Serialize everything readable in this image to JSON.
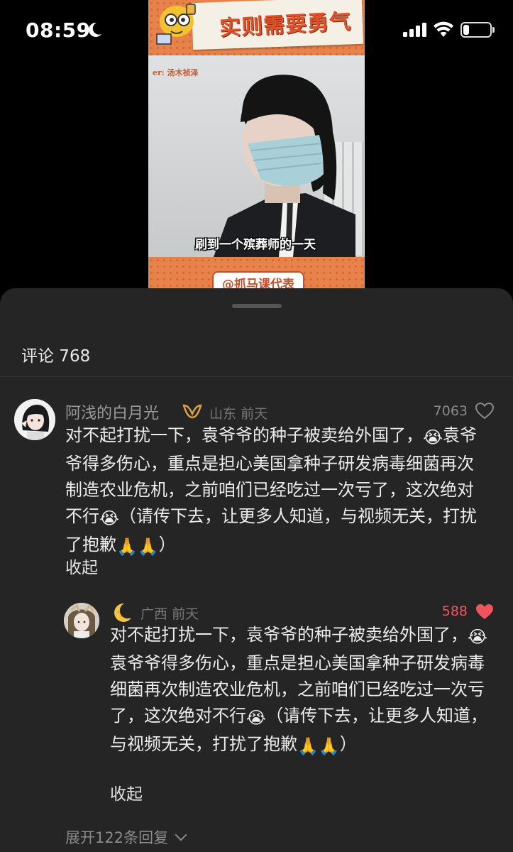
{
  "status_bar": {
    "time": "08:59",
    "battery_level": 0.22
  },
  "video": {
    "headline": "实则需要勇气",
    "credit": "er: 汤木祯泽",
    "caption": "刷到一个殡葬师的一天",
    "handle": "@抓马课代表"
  },
  "comments": {
    "title": "评论 768",
    "main": {
      "username": "阿浅的白月光",
      "location": "山东",
      "time": "前天",
      "likes": "7063",
      "text_1": "对不起打扰一下，袁爷爷的种子被卖给外国了，",
      "emoji_cry": "😭",
      "text_2": "袁爷爷得多伤心，重点是担心美国拿种子研发病毒细菌再次制造农业危机，之前咱们已经吃过一次亏了，这次绝对不行",
      "text_3": "（请传下去，让更多人知道，与视频无关，打扰了抱歉",
      "emoji_pray": "🙏🙏",
      "text_4": "）",
      "collapse": "收起"
    },
    "reply": {
      "username": "🌙",
      "location": "广西",
      "time": "前天",
      "likes": "588",
      "text_1": "对不起打扰一下，袁爷爷的种子被卖给外国了，",
      "emoji_cry": "😭",
      "text_2": "袁爷爷得多伤心，重点是担心美国拿种子研发病毒细菌再次制造农业危机，之前咱们已经吃过一次亏了，这次绝对不行",
      "text_3": "（请传下去，让更多人知道，与视频无关，打扰了抱歉",
      "emoji_pray": "🙏🙏",
      "text_4": "）",
      "collapse": "收起"
    },
    "expand_replies": "展开122条回复"
  },
  "colors": {
    "sheet_bg": "#252525",
    "liked_red": "#f0555d",
    "video_orange": "#e6824a"
  },
  "icons": [
    "moon-icon",
    "signal-icon",
    "wifi-icon",
    "battery-icon",
    "vip-icon",
    "heart-icon",
    "heart-filled-icon",
    "chevron-down-icon"
  ]
}
